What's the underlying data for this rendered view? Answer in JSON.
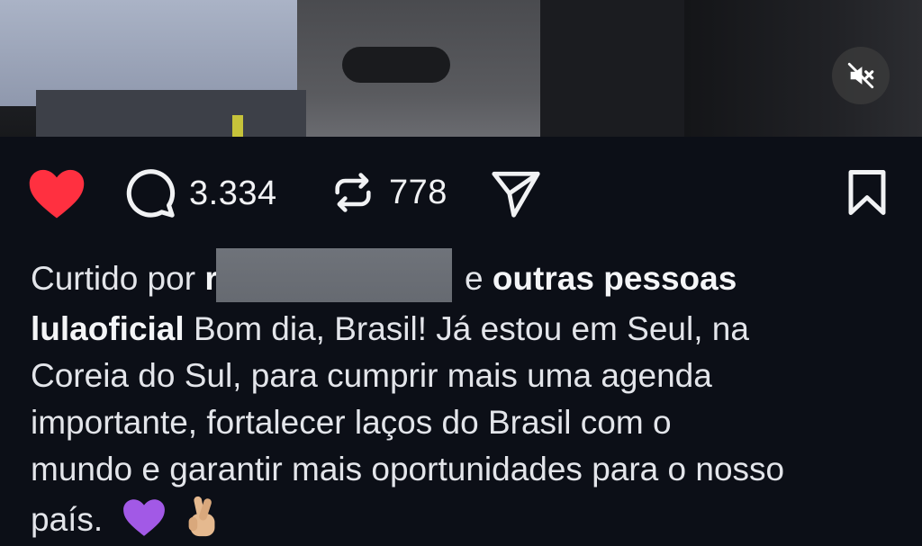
{
  "video": {
    "mute_icon": "speaker-muted-icon"
  },
  "actions": {
    "like_icon": "heart-filled-icon",
    "like_color": "#ff3040",
    "comment_icon": "comment-bubble-icon",
    "comment_count": "3.334",
    "repost_icon": "repost-arrows-icon",
    "repost_count": "778",
    "share_icon": "paper-plane-icon",
    "save_icon": "bookmark-icon"
  },
  "likes": {
    "prefix": "Curtido por",
    "name_visible_start": "r",
    "name_redacted": true,
    "connector": "e",
    "others": "outras pessoas"
  },
  "caption": {
    "username": "lulaoficial",
    "line1_text": "Bom dia, Brasil! Já estou em Seul, na",
    "line2": "Coreia do Sul, para cumprir mais uma agenda",
    "line3": "importante, fortalecer laços do Brasil com o",
    "line4": "mundo e garantir mais oportunidades para o nosso",
    "line5_text": "país.",
    "emojis": [
      "purple-heart-icon",
      "crossed-fingers-icon"
    ],
    "purple_heart_color": "#a259e6"
  }
}
